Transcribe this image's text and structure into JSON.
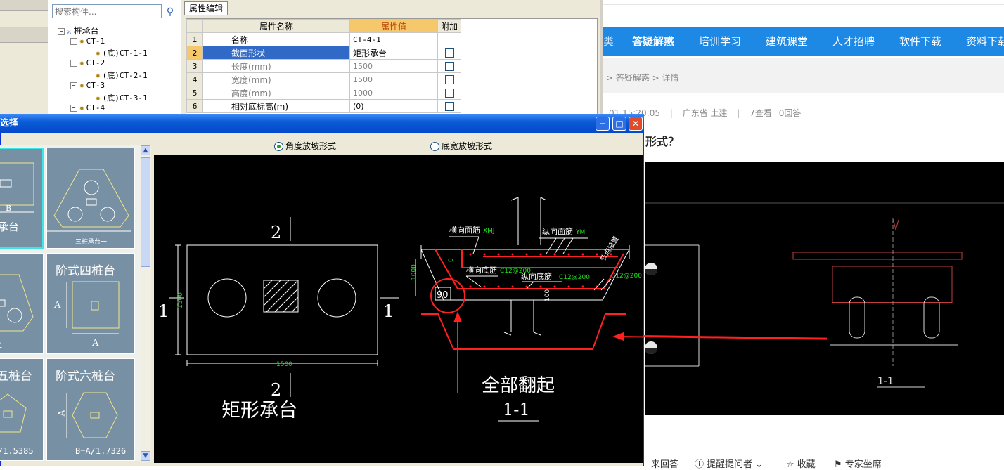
{
  "tree": {
    "search_placeholder": "搜索构件...",
    "root": "桩承台",
    "items": [
      {
        "label": "CT-1",
        "child": "(底)CT-1-1"
      },
      {
        "label": "CT-2",
        "child": "(底)CT-2-1"
      },
      {
        "label": "CT-3",
        "child": "(底)CT-3-1"
      },
      {
        "label": "CT-4",
        "child": ""
      }
    ]
  },
  "props": {
    "tab": "属性编辑",
    "col_name": "属性名称",
    "col_value": "属性值",
    "col_extra": "附加",
    "rows": [
      {
        "n": "1",
        "name": "名称",
        "value": "CT-4-1"
      },
      {
        "n": "2",
        "name": "截面形状",
        "value": "矩形承台"
      },
      {
        "n": "3",
        "name": "长度(mm)",
        "value": "1500"
      },
      {
        "n": "4",
        "name": "宽度(mm)",
        "value": "1500"
      },
      {
        "n": "5",
        "name": "高度(mm)",
        "value": "1000"
      },
      {
        "n": "6",
        "name": "相对底标高(m)",
        "value": "(0)"
      }
    ]
  },
  "web": {
    "nav": [
      "答疑解惑",
      "培训学习",
      "建筑课堂",
      "人才招聘",
      "软件下载",
      "资料下载"
    ],
    "nav_prefix": "类",
    "breadcrumb": "> 答疑解惑 > 详情",
    "meta_time": "01 15:20:05",
    "meta_location": "广东省  土建",
    "meta_views": "7查看",
    "meta_answers": "0回答",
    "title_fragment": "形式？",
    "footer": {
      "answer": "来回答",
      "remind": "提醒提问者",
      "collect": "收藏",
      "expert": "专家坐席"
    },
    "cad_section_label": "1-1"
  },
  "dialog": {
    "title": "选择",
    "radio_angle": "角度放坡形式",
    "radio_width": "底宽放坡形式",
    "thumbs": {
      "t1_label": "形承台",
      "t1_dim": "B",
      "t2_label": "三桩承台一",
      "t3_label": "台二",
      "t4_label": "阶式四桩台",
      "t4_dim_a": "A",
      "t5_label": "五桩台",
      "t5_formula": "/1.5385",
      "t6_label": "阶式六桩台",
      "t6_formula": "B=A/1.7326",
      "t6_dim_a": "A"
    },
    "drawing": {
      "plan_label": "矩形承台",
      "mark_top": "2",
      "mark_bottom": "2",
      "mark_left": "1",
      "mark_right": "1",
      "dim_width": "1500",
      "dim_height": "1500",
      "top_bar": "横向面筋",
      "top_bar_code": "XMJ",
      "long_top_bar": "纵向面筋",
      "long_top_bar_code": "YMJ",
      "bottom_bar": "横向底筋",
      "bottom_bar_code": "C12@200",
      "long_bottom_bar": "纵向底筋",
      "long_bottom_bar_code": "C12@200",
      "side_code": "C12@200",
      "slope_note": "节点设置",
      "dim_depth": "1000",
      "dim_100": "100",
      "dim_0": "0",
      "angle": "90",
      "annotation": "全部翻起",
      "section": "1-1"
    }
  },
  "colors": {
    "nav_blue": "#1e88e5",
    "title_blue": "#0a5bd6",
    "rebar_red": "#ff2020",
    "cad_green": "#20e020",
    "select_blue": "#3169c6"
  }
}
